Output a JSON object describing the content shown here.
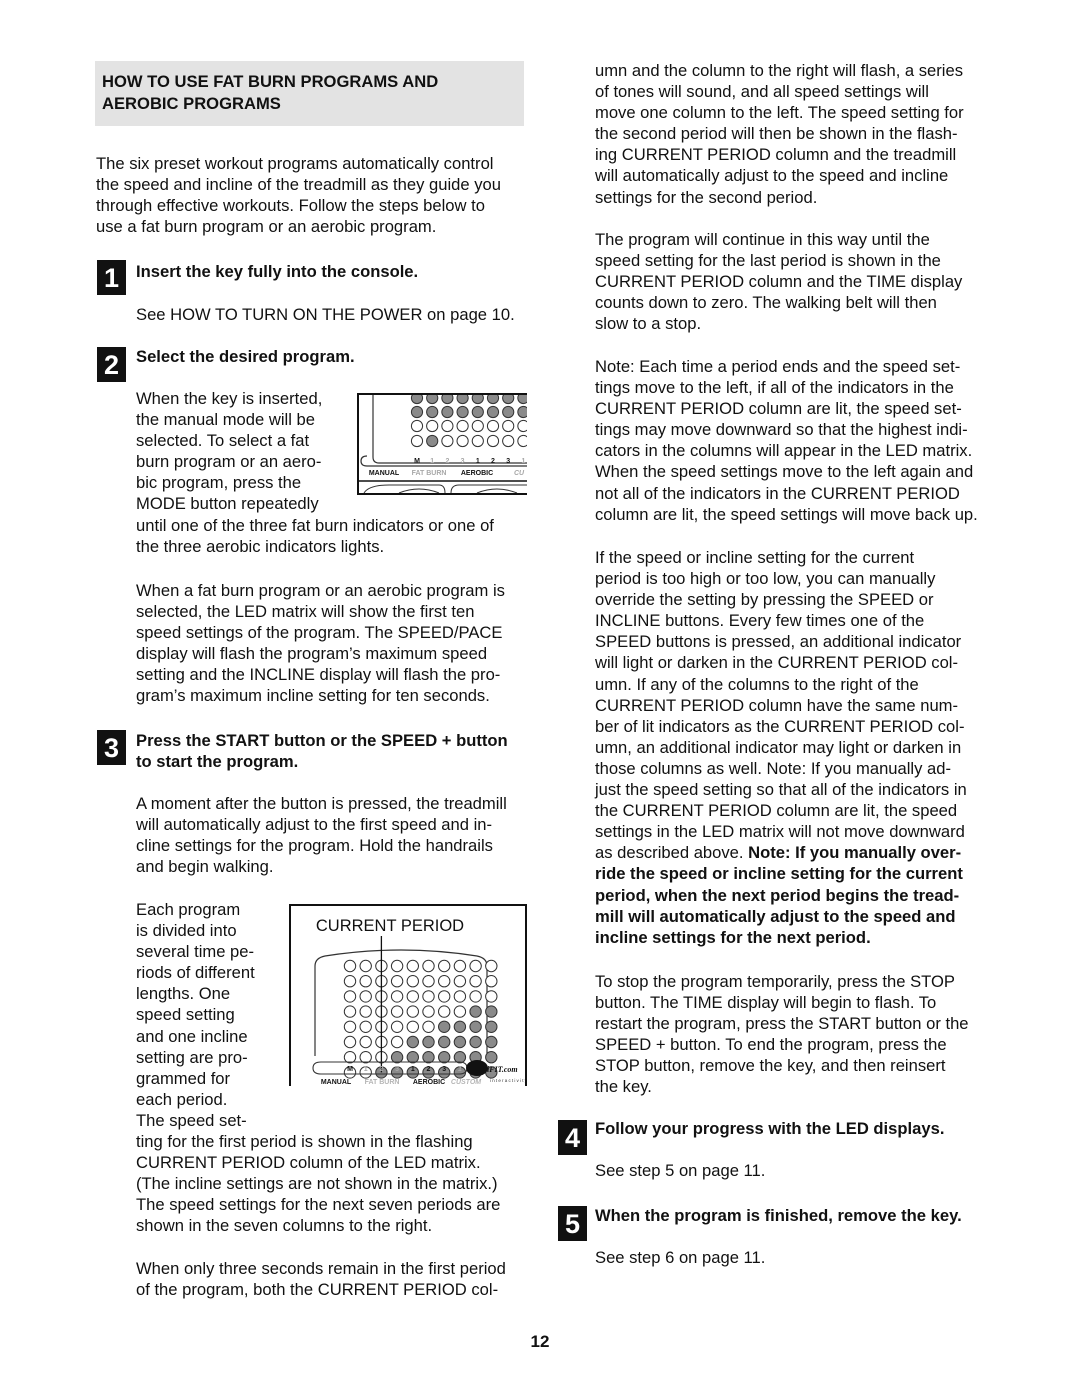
{
  "page": {
    "number": "12"
  },
  "section": {
    "title_lines": [
      "HOW TO USE FAT BURN PROGRAMS AND",
      "AEROBIC PROGRAMS"
    ]
  },
  "left": {
    "intro_lines": [
      "The six preset workout programs automatically control",
      "the speed and incline of the treadmill as they guide you",
      "through effective workouts. Follow the steps below to",
      "use a fat burn program or an aerobic program."
    ],
    "step1": {
      "number": "1",
      "heading": "Insert the key fully into the console.",
      "body": "See HOW TO TURN ON THE POWER on page 10."
    },
    "step2": {
      "number": "2",
      "heading": "Select the desired program.",
      "wrap_lines": [
        "When the key is inserted,",
        "the manual mode will be",
        "selected. To select a fat",
        "burn program or an aero-",
        "bic program, press the",
        "MODE button repeatedly"
      ],
      "full_lines": [
        "until one of the three fat burn indicators or one of",
        "the three aerobic indicators lights."
      ],
      "para2_lines": [
        "When a fat burn program or an aerobic program is",
        "selected, the LED matrix will show the first ten",
        "speed settings of the program. The SPEED/PACE",
        "display will flash the program’s maximum speed",
        "setting and the INCLINE display will flash the pro-",
        "gram’s maximum incline setting for ten seconds."
      ]
    },
    "step3": {
      "number": "3",
      "heading_lines": [
        "Press the START button or the SPEED + button",
        "to start the program."
      ],
      "para1_lines": [
        "A moment after the button is pressed, the treadmill",
        "will automatically adjust to the first speed and in-",
        "cline settings for the program. Hold the handrails",
        "and begin walking."
      ],
      "wrap_lines": [
        "Each program",
        "is divided into",
        "several time pe-",
        "riods of different",
        "lengths. One",
        "speed setting",
        "and one incline",
        "setting are pro-",
        "grammed for",
        "each period.",
        "The speed set-"
      ],
      "full_lines": [
        "ting for the first period is shown in the flashing",
        "CURRENT PERIOD column of the LED matrix.",
        "(The incline settings are not shown in the matrix.)",
        "The speed settings for the next seven periods are",
        "shown in the seven columns to the right."
      ],
      "para3_lines": [
        "When only three seconds remain in the first period",
        "of the program, both the CURRENT PERIOD col-"
      ]
    }
  },
  "right": {
    "para1_lines": [
      "umn and the column to the right will flash, a series",
      "of tones will sound, and all speed settings will",
      "move one column to the left. The speed setting for",
      "the second period will then be shown in the flash-",
      "ing CURRENT PERIOD column and the treadmill",
      "will automatically adjust to the speed and incline",
      "settings for the second period."
    ],
    "para2_lines": [
      "The program will continue in this way until the",
      "speed setting for the last period is shown in the",
      "CURRENT PERIOD column and the TIME display",
      "counts down to zero. The walking belt will then",
      "slow to a stop."
    ],
    "para3_lines": [
      "Note: Each time a period ends and the speed set-",
      "tings move to the left, if all of the indicators in the",
      "CURRENT PERIOD column are lit, the speed set-",
      "tings may move downward so that the highest indi-",
      "cators in the columns will appear in the LED matrix.",
      "When the speed settings move to the left again and",
      "not all of the indicators in the CURRENT PERIOD",
      "column are lit, the speed settings will move back up."
    ],
    "para4_lines": [
      "If the speed or incline setting for the current",
      "period is too high or too low, you can manually",
      "override the setting by pressing the SPEED or",
      "INCLINE buttons. Every few times one of the",
      "SPEED buttons is pressed, an additional indicator",
      "will light or darken in the CURRENT PERIOD col-",
      "umn. If any of the columns to the right of the",
      "CURRENT PERIOD column have the same num-",
      "ber of lit indicators as the CURRENT PERIOD col-",
      "umn, an additional indicator may light or darken in",
      "those columns as well. Note: If you manually ad-",
      "just the speed setting so that all of the indicators in",
      "the CURRENT PERIOD column are lit, the speed",
      "settings in the LED matrix will not move downward"
    ],
    "para4_mixed_line": {
      "normal": "as described above. ",
      "bold": "Note: If you manually over-"
    },
    "para4_bold_lines": [
      "ride the speed or incline setting for the current",
      "period, when the next period begins the tread-",
      "mill will automatically adjust to the speed and",
      "incline settings for the next period."
    ],
    "para5_lines": [
      "To stop the program temporarily, press the STOP",
      "button. The TIME display will begin to flash. To",
      "restart the program, press the START button or the",
      "SPEED + button. To end the program, press the",
      "STOP button, remove the key, and then reinsert",
      "the key."
    ],
    "step4": {
      "number": "4",
      "heading": "Follow your progress with the LED displays.",
      "body": "See step 5 on page 11."
    },
    "step5": {
      "number": "5",
      "heading": "When the program is finished, remove the key.",
      "body": "See step 6 on page 11."
    }
  },
  "figure_mode": {
    "indicator_labels": [
      "M",
      "1",
      "2",
      "3",
      "1",
      "2",
      "3",
      "1"
    ],
    "group_labels": [
      "MANUAL",
      "FAT BURN",
      "AEROBIC",
      "CU"
    ],
    "rows_lit": [
      [
        1,
        1,
        1,
        1,
        1,
        1,
        1,
        1
      ],
      [
        1,
        1,
        1,
        1,
        1,
        1,
        1,
        1
      ],
      [
        0,
        0,
        0,
        0,
        0,
        0,
        0,
        0
      ],
      [
        0,
        1,
        0,
        0,
        0,
        0,
        0,
        0
      ]
    ],
    "selected_indicator": "FAT BURN 1"
  },
  "figure_matrix": {
    "title": "CURRENT PERIOD",
    "column_lit_counts": [
      0,
      0,
      1,
      2,
      3,
      3,
      4,
      4,
      5,
      5
    ],
    "current_period_column": 3,
    "indicator_labels": [
      "M",
      "1",
      "2",
      "3",
      "1",
      "2",
      "3",
      "1",
      "2"
    ],
    "group_labels": [
      "MANUAL",
      "FAT BURN",
      "AEROBIC",
      "CUSTOM"
    ],
    "logo_text": "iFIT.com",
    "logo_sub": "interactivity"
  },
  "colors": {
    "header_bg": "#e3e3e3",
    "led_lit": "#8a8a8a",
    "led_off": "#ffffff",
    "muted_label": "#a8a8a8",
    "custom_label": "#b5b5b5"
  }
}
